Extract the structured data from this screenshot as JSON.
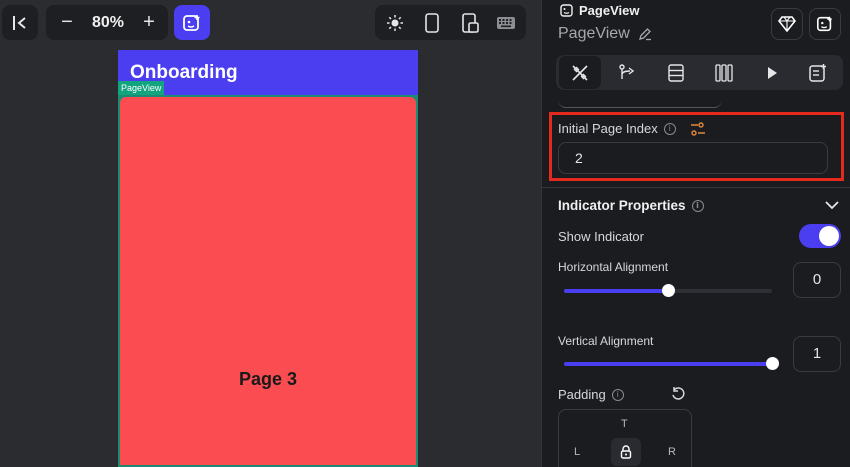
{
  "canvas": {
    "zoom": "80%",
    "zoom_minus": "−",
    "zoom_plus": "+",
    "icons": [
      "sidebar-collapse-icon",
      "ai-assist-icon",
      "sun-icon",
      "phone-icon",
      "tablet-icon",
      "keyboard-icon"
    ]
  },
  "preview": {
    "appbar_title": "Onboarding",
    "widget_tag": "PageView",
    "page_label": "Page 3",
    "colors": {
      "appbar": "#4b3ef0",
      "page": "#fb4c52",
      "tag": "#12a37f"
    }
  },
  "panel": {
    "widget_type": "PageView",
    "widget_name": "PageView",
    "tabs": [
      "properties",
      "actions",
      "backend-query",
      "layout",
      "preview",
      "notes"
    ],
    "initial_page_index": {
      "label": "Initial Page Index",
      "value": "2"
    },
    "indicator": {
      "title": "Indicator Properties",
      "show_label": "Show Indicator",
      "show_value": true,
      "horizontal": {
        "label": "Horizontal Alignment",
        "value": "0",
        "fraction": 0.5
      },
      "vertical": {
        "label": "Vertical Alignment",
        "value": "1",
        "fraction": 1.0
      }
    },
    "padding": {
      "label": "Padding",
      "top": "T",
      "left": "L",
      "right": "R"
    },
    "accent": "#4b3ef0",
    "highlight": "#e42a1c"
  }
}
